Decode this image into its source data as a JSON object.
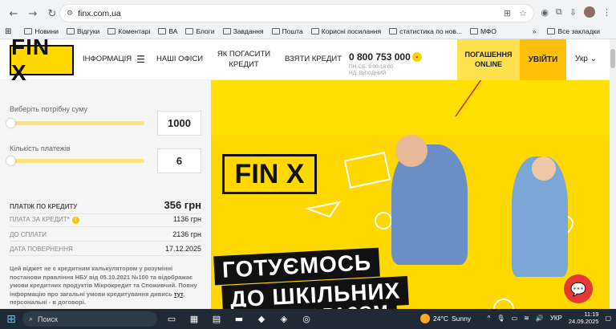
{
  "browser": {
    "url": "finx.com.ua",
    "bookmarks": [
      "Новини",
      "Відгуки",
      "Коментарі",
      "ВА",
      "Блоги",
      "Завдання",
      "Пошта",
      "Корисні посилання",
      "статистика по нов...",
      "МФО"
    ],
    "all_bookmarks": "Все закладки",
    "more": "»"
  },
  "header": {
    "logo": "FIN X",
    "nav": {
      "info": "ІНФОРМАЦІЯ",
      "offices": "НАШІ ОФІСИ",
      "how_to_pay": "ЯК ПОГАСИТИ КРЕДИТ",
      "get_credit": "ВЗЯТИ КРЕДИТ"
    },
    "phone": "0 800 753 000",
    "hours_1": "ПН-СБ: 9:00-18:00",
    "hours_2": "НД: ВИХІДНИЙ",
    "pay_online": "ПОГАШЕННЯ ONLINE",
    "login": "УВІЙТИ",
    "lang": "Укр"
  },
  "calculator": {
    "sum_label": "Виберіть потрібну суму",
    "sum_value": "1000",
    "payments_label": "Кількість платежів",
    "payments_value": "6",
    "rows": {
      "payment_label": "ПЛАТІЖ ПО КРЕДИТУ",
      "payment_value": "356 грн",
      "fee_label": "ПЛАТА ЗА КРЕДИТ*",
      "fee_value": "1136 грн",
      "total_label": "ДО СПЛАТИ",
      "total_value": "2136 грн",
      "return_label": "ДАТА ПОВЕРНЕННЯ",
      "return_value": "17.12.2025"
    },
    "disclaimer_1": "Цей віджет не є кредитним калькулятором у розумінні постанови правління НБУ від 05.10.2021 №100 та відображає умови кредитних продуктів Мікрокредит та Споживчий. Повну інформацію про загальні умови кредитування дивись ",
    "disclaimer_link": "тут",
    "disclaimer_2": ", персональні - в договорі."
  },
  "banner": {
    "logo": "FIN X",
    "line_1": "ГОТУЄМОСЬ",
    "line_2": "ДО ШКІЛЬНИХ",
    "line_3": "ВИТРАТ РАЗОМ"
  },
  "taskbar": {
    "search": "Поиск",
    "weather_temp": "24°C",
    "weather_text": "Sunny",
    "lang": "УКР",
    "time": "11:19",
    "date": "24.09.2025"
  },
  "colors": {
    "brand_yellow": "#ffd800",
    "accent": "#ffc107",
    "chat": "#e53935"
  }
}
